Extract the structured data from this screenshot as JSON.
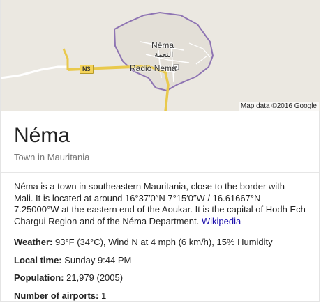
{
  "map": {
    "city_label": "Néma",
    "city_label_arabic": "النعمة",
    "poi_label": "Radio Nema",
    "road_shield": "N3",
    "attribution": "Map data ©2016 Google",
    "colors": {
      "land": "#ebe8e1",
      "road": "#ffffff",
      "highway": "#f4d35a",
      "boundary": "#8e74b3"
    }
  },
  "entity": {
    "title": "Néma",
    "subtitle": "Town in Mauritania"
  },
  "description": {
    "text": "Néma is a town in southeastern Mauritania, close to the border with Mali. It is located at around 16°37′0″N 7°15′0″W / 16.61667°N 7.25000°W at the eastern end of the Aoukar. It is the capital of Hodh Ech Chargui Region and of the Néma Department.",
    "source_link": "Wikipedia"
  },
  "facts": [
    {
      "label": "Weather:",
      "value": " 93°F (34°C), Wind N at 4 mph (6 km/h), 15% Humidity"
    },
    {
      "label": "Local time:",
      "value": " Sunday 9:44 PM"
    },
    {
      "label": "Population:",
      "value": " 21,979 (2005)"
    },
    {
      "label": "Number of airports:",
      "value": " 1"
    }
  ]
}
